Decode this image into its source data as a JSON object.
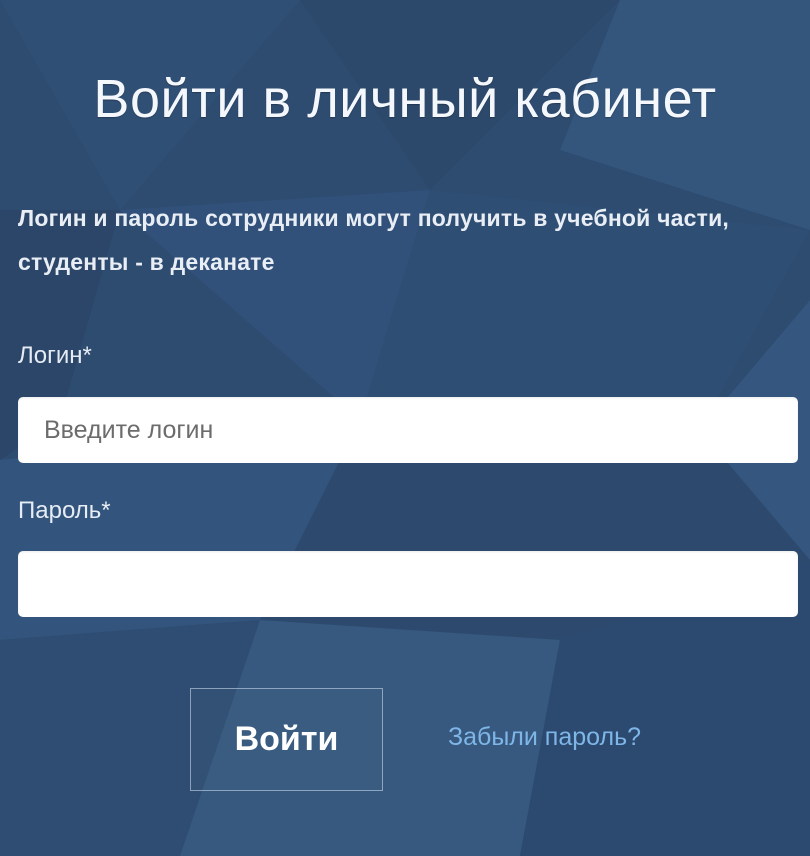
{
  "colors": {
    "background": "#2f4d72",
    "accent_link": "#7eb6e8",
    "input_background": "#ffffff"
  },
  "page": {
    "title": "Войти в личный кабинет",
    "notice": "Логин и пароль сотрудники могут получить в учебной части, студенты - в деканате"
  },
  "form": {
    "login_label": "Логин*",
    "login_placeholder": "Введите логин",
    "login_value": "",
    "password_label": "Пароль*",
    "password_value": "",
    "submit_label": "Войти",
    "forgot_label": "Забыли пароль?"
  }
}
